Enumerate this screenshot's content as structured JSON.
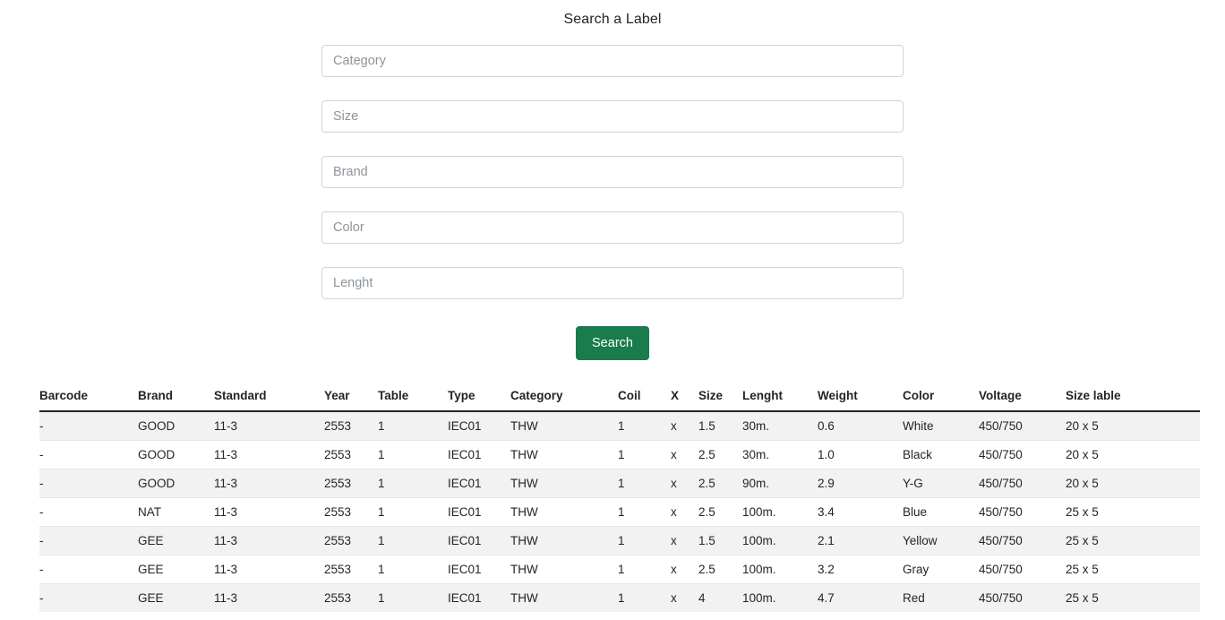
{
  "page": {
    "title": "Search a Label"
  },
  "search_form": {
    "fields": [
      {
        "name": "category",
        "placeholder": "Category",
        "value": ""
      },
      {
        "name": "size",
        "placeholder": "Size",
        "value": ""
      },
      {
        "name": "brand",
        "placeholder": "Brand",
        "value": ""
      },
      {
        "name": "color",
        "placeholder": "Color",
        "value": ""
      },
      {
        "name": "lenght",
        "placeholder": "Lenght",
        "value": ""
      }
    ],
    "submit_label": "Search",
    "submit_color": "#1a7b4c"
  },
  "results_table": {
    "columns": [
      "Barcode",
      "Brand",
      "Standard",
      "Year",
      "Table",
      "Type",
      "Category",
      "Coil",
      "X",
      "Size",
      "Lenght",
      "Weight",
      "Color",
      "Voltage",
      "Size lable"
    ],
    "rows": [
      [
        "-",
        "GOOD",
        "11-3",
        "2553",
        "1",
        "IEC01",
        "THW",
        "1",
        "x",
        "1.5",
        "30m.",
        "0.6",
        "White",
        "450/750",
        "20 x 5"
      ],
      [
        "-",
        "GOOD",
        "11-3",
        "2553",
        "1",
        "IEC01",
        "THW",
        "1",
        "x",
        "2.5",
        "30m.",
        "1.0",
        "Black",
        "450/750",
        "20 x 5"
      ],
      [
        "-",
        "GOOD",
        "11-3",
        "2553",
        "1",
        "IEC01",
        "THW",
        "1",
        "x",
        "2.5",
        "90m.",
        "2.9",
        "Y-G",
        "450/750",
        "20 x 5"
      ],
      [
        "-",
        "NAT",
        "11-3",
        "2553",
        "1",
        "IEC01",
        "THW",
        "1",
        "x",
        "2.5",
        "100m.",
        "3.4",
        "Blue",
        "450/750",
        "25 x 5"
      ],
      [
        "-",
        "GEE",
        "11-3",
        "2553",
        "1",
        "IEC01",
        "THW",
        "1",
        "x",
        "1.5",
        "100m.",
        "2.1",
        "Yellow",
        "450/750",
        "25 x 5"
      ],
      [
        "-",
        "GEE",
        "11-3",
        "2553",
        "1",
        "IEC01",
        "THW",
        "1",
        "x",
        "2.5",
        "100m.",
        "3.2",
        "Gray",
        "450/750",
        "25 x 5"
      ],
      [
        "-",
        "GEE",
        "11-3",
        "2553",
        "1",
        "IEC01",
        "THW",
        "1",
        "x",
        "4",
        "100m.",
        "4.7",
        "Red",
        "450/750",
        "25 x 5"
      ]
    ]
  }
}
